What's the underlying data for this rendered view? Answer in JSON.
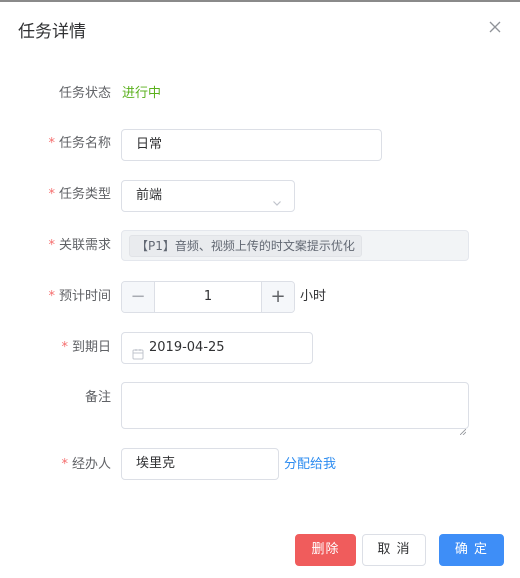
{
  "dialog": {
    "title": "任务详情",
    "close_icon": "close-icon"
  },
  "form": {
    "required_mark": "*",
    "status": {
      "label": "任务状态",
      "value": "进行中",
      "color": "#5ab01c"
    },
    "name": {
      "label": "任务名称",
      "value": "日常"
    },
    "type": {
      "label": "任务类型",
      "value": "前端",
      "icon": "chevron-down-icon"
    },
    "requirement": {
      "label": "关联需求",
      "tag": "【P1】音频、视频上传的时文案提示优化"
    },
    "estimate": {
      "label": "预计时间",
      "value": "1",
      "minus": "−",
      "plus": "+",
      "unit": "小时"
    },
    "due_date": {
      "label": "到期日",
      "value": "2019-04-25",
      "icon": "calendar-icon"
    },
    "remark": {
      "label": "备注",
      "value": ""
    },
    "assignee": {
      "label": "经办人",
      "value": "埃里克",
      "assign_link": "分配给我",
      "link_color": "#2d8cf0"
    }
  },
  "footer": {
    "delete_label": "删除",
    "cancel_label": "取 消",
    "confirm_label": "确 定",
    "colors": {
      "danger": "#f05c5c",
      "primary": "#3e8ef7"
    }
  }
}
